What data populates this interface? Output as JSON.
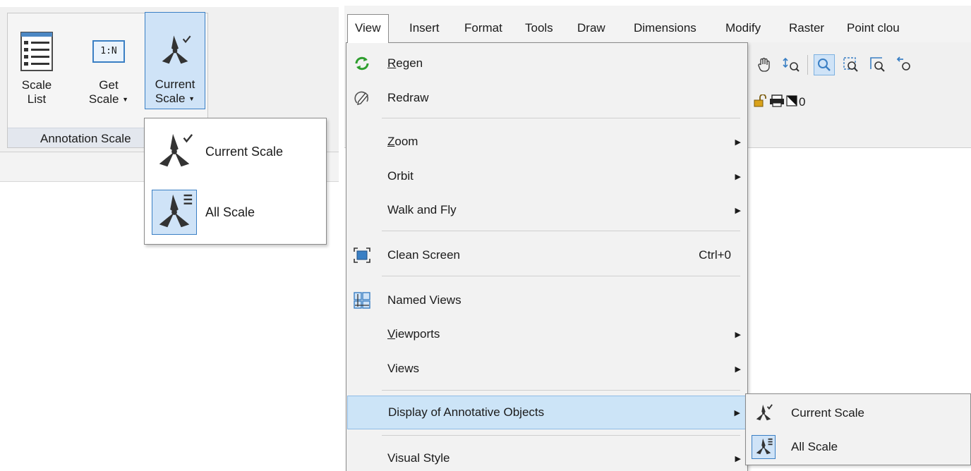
{
  "ribbon": {
    "buttons": [
      {
        "line1": "Scale",
        "line2": "List",
        "icon": "scale-list-icon"
      },
      {
        "line1": "Get",
        "line2": "Scale",
        "icon": "get-scale-icon",
        "icon_text": "1:N"
      },
      {
        "line1": "Current",
        "line2": "Scale",
        "icon": "annotative-current-scale-icon"
      }
    ],
    "panel_title": "Annotation Scale",
    "dropdown_items": [
      {
        "label": "Current Scale",
        "icon": "annotative-current-scale-icon"
      },
      {
        "label": "All Scale",
        "icon": "annotative-all-scale-icon"
      }
    ]
  },
  "menubar": {
    "items": [
      "View",
      "Insert",
      "Format",
      "Tools",
      "Draw",
      "Dimensions",
      "Modify",
      "Raster",
      "Point clou"
    ]
  },
  "toolbar": {
    "layer_value": "0"
  },
  "view_menu": {
    "items": [
      {
        "label": "Regen",
        "mnemonic": "R",
        "rest": "egen",
        "icon": "regen-icon"
      },
      {
        "label": "Redraw",
        "icon": "redraw-icon"
      },
      {
        "label": "Zoom",
        "mnemonic": "Z",
        "rest": "oom",
        "submenu": true
      },
      {
        "label": "Orbit",
        "submenu": true
      },
      {
        "label": "Walk and Fly",
        "submenu": true
      },
      {
        "label": "Clean Screen",
        "shortcut": "Ctrl+0",
        "icon": "clean-screen-icon"
      },
      {
        "label": "Named Views",
        "icon": "named-views-icon"
      },
      {
        "label": "Viewports",
        "mnemonic": "V",
        "rest": "iewports",
        "submenu": true
      },
      {
        "label": "Views",
        "submenu": true
      },
      {
        "label": "Display of Annotative Objects",
        "submenu": true
      },
      {
        "label": "Visual Style",
        "submenu": true
      }
    ]
  },
  "submenu": {
    "items": [
      {
        "label": "Current Scale",
        "icon": "annotative-current-scale-icon"
      },
      {
        "label": "All Scale",
        "icon": "annotative-all-scale-icon"
      }
    ]
  },
  "colors": {
    "accent": "#3a7fc4",
    "hover": "#cce4f7",
    "regen_green": "#2e9e2e"
  }
}
